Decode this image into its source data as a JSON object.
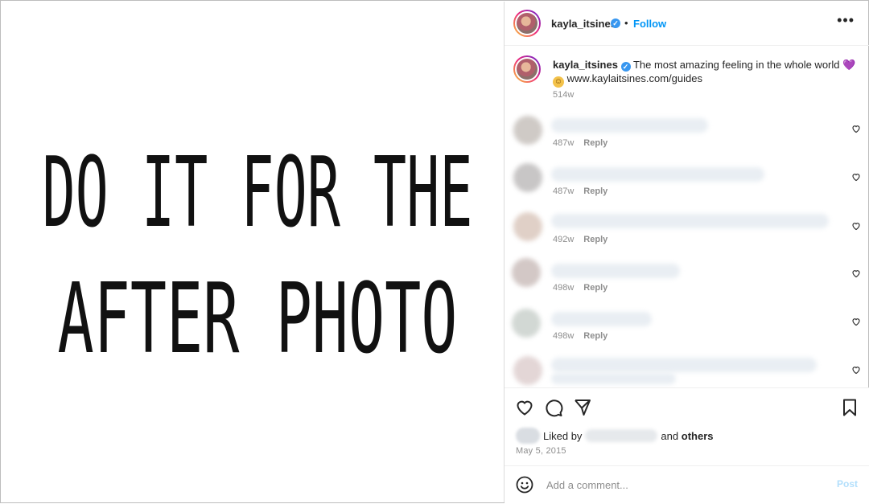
{
  "post": {
    "image_text_line1": "DO IT FOR THE",
    "image_text_line2": "AFTER PHOTO"
  },
  "header": {
    "username": "kayla_itsines",
    "separator": "•",
    "follow_label": "Follow",
    "more_label": "•••"
  },
  "caption": {
    "username": "kayla_itsines",
    "text": "The most amazing feeling in the whole world",
    "heart": "💜",
    "link": "www.kaylaitsines.com/guides",
    "time": "514w"
  },
  "comments": [
    {
      "time": "487w",
      "reply": "Reply"
    },
    {
      "time": "487w",
      "reply": "Reply"
    },
    {
      "time": "492w",
      "reply": "Reply"
    },
    {
      "time": "498w",
      "reply": "Reply"
    },
    {
      "time": "498w",
      "reply": "Reply"
    }
  ],
  "likes": {
    "prefix": "Liked by",
    "suffix": "and",
    "others": "others"
  },
  "date": "May 5, 2015",
  "add_comment": {
    "placeholder": "Add a comment...",
    "post_label": "Post"
  },
  "colors": {
    "accent": "#0095f6",
    "verified": "#3897f0",
    "muted": "#8e8e8e"
  }
}
